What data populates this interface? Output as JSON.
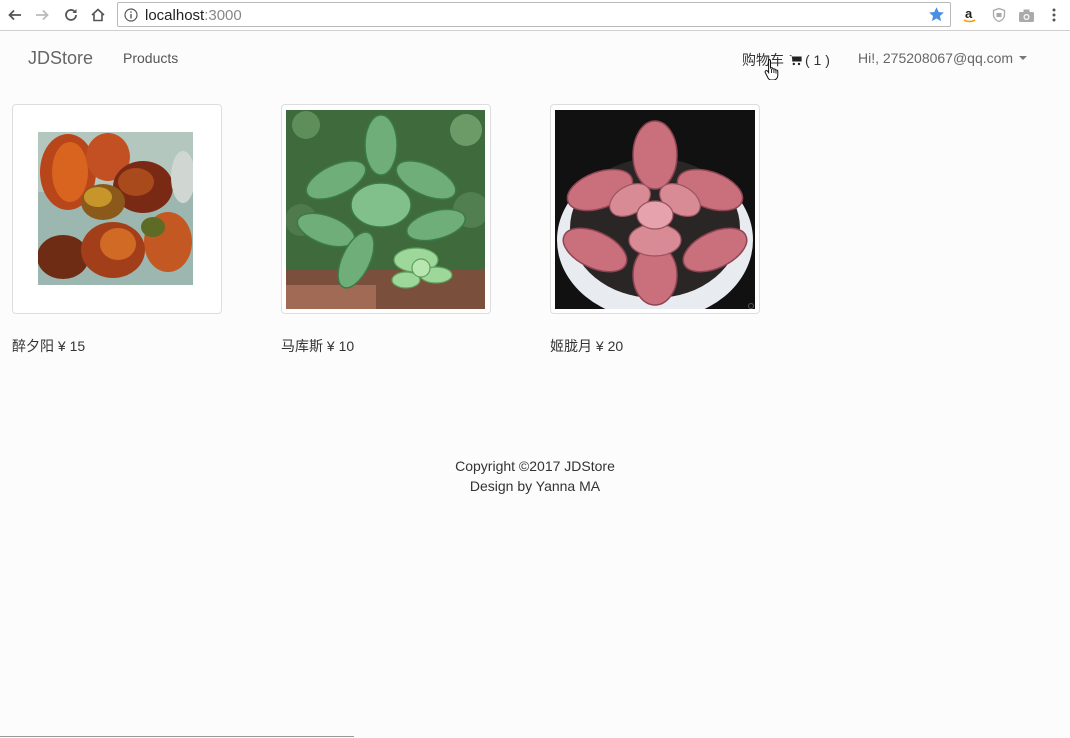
{
  "browser": {
    "url_host": "localhost",
    "url_port": ":3000",
    "icons": [
      "back-arrow-icon",
      "forward-arrow-icon",
      "reload-icon",
      "home-icon",
      "info-icon",
      "bookmark-star-icon",
      "amazon-extension-icon",
      "shield-extension-icon",
      "camera-extension-icon",
      "more-menu-icon"
    ]
  },
  "navbar": {
    "brand": "JDStore",
    "products_link": "Products",
    "cart_label": "购物车",
    "cart_count": "( 1 )",
    "user_label": "Hi!, 275208067@qq.com"
  },
  "products": [
    {
      "name": "醉夕阳",
      "price": "¥ 15"
    },
    {
      "name": "马库斯",
      "price": "¥ 10"
    },
    {
      "name": "姬胧月",
      "price": "¥ 20"
    }
  ],
  "footer": {
    "copyright": "Copyright ©2017 JDStore",
    "design": "Design by Yanna MA"
  },
  "colors": {
    "accent_star": "#4a90e2",
    "page_bg": "#fdfcfc"
  }
}
